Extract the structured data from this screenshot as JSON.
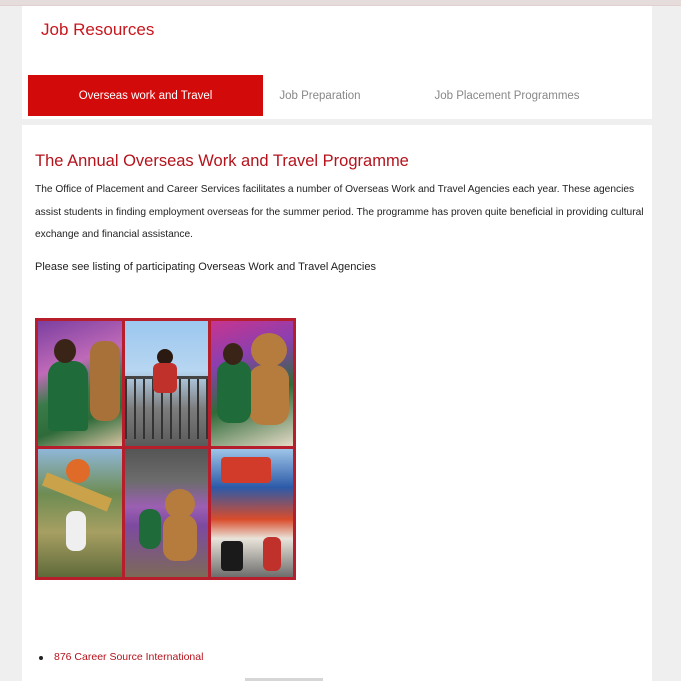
{
  "header": {
    "title": "Job Resources"
  },
  "tabs": [
    {
      "label": "Overseas work and Travel",
      "active": true
    },
    {
      "label": "Job Preparation",
      "active": false
    },
    {
      "label": "Job Placement Programmes",
      "active": false
    }
  ],
  "content": {
    "heading": "The Annual Overseas Work and Travel Programme",
    "paragraph": "The Office of Placement and Career Services facilitates a number of Overseas Work and Travel Agencies each year. These agencies assist students in finding employment overseas for the summer period.  The programme has proven quite beneficial in providing cultural exchange and financial assistance.",
    "listing_note": "Please see listing of participating Overseas Work and Travel Agencies",
    "agencies": [
      {
        "name": "876 Career Source International"
      }
    ]
  },
  "colors": {
    "accent": "#d20a0a",
    "heading": "#b5121b",
    "collage_border": "#b51e2a"
  }
}
